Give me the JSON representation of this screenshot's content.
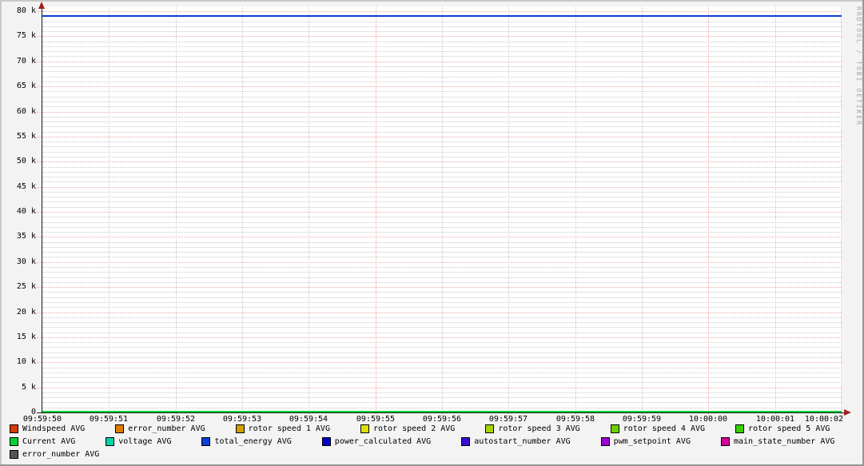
{
  "watermark": "RRDTOOL / TOBI OETIKER",
  "colors": {
    "background": "#f3f3f3",
    "canvas": "#ffffff",
    "grid_minor": "#c9c9c9",
    "grid_major": "#f2a5a5",
    "axis": "#1c1c1c",
    "arrow": "#a32020",
    "shade_a": "#c8c8c8",
    "shade_b": "#969696",
    "watermark_color": "#a6a6a6"
  },
  "legend_layout": [
    7,
    7,
    1
  ],
  "chart_data": {
    "type": "line",
    "title": "",
    "xlabel": "",
    "ylabel": "",
    "ylim": [
      0,
      80000
    ],
    "x_range": {
      "start": "09:59:50",
      "end": "10:00:02",
      "step_seconds": 1
    },
    "grid": {
      "y_minor_step": 1000,
      "y_major_step": 5000,
      "x_minor_step_s": 1,
      "x_major_step_s": 5
    },
    "x_labels": [
      "09:59:50",
      "09:59:51",
      "09:59:52",
      "09:59:53",
      "09:59:54",
      "09:59:55",
      "09:59:56",
      "09:59:57",
      "09:59:58",
      "09:59:59",
      "10:00:00",
      "10:00:01",
      "10:00:02"
    ],
    "y_ticks": [
      {
        "value": 0,
        "label": "0"
      },
      {
        "value": 5000,
        "label": "5 k"
      },
      {
        "value": 10000,
        "label": "10 k"
      },
      {
        "value": 15000,
        "label": "15 k"
      },
      {
        "value": 20000,
        "label": "20 k"
      },
      {
        "value": 25000,
        "label": "25 k"
      },
      {
        "value": 30000,
        "label": "30 k"
      },
      {
        "value": 35000,
        "label": "35 k"
      },
      {
        "value": 40000,
        "label": "40 k"
      },
      {
        "value": 45000,
        "label": "45 k"
      },
      {
        "value": 50000,
        "label": "50 k"
      },
      {
        "value": 55000,
        "label": "55 k"
      },
      {
        "value": 60000,
        "label": "60 k"
      },
      {
        "value": 65000,
        "label": "65 k"
      },
      {
        "value": 70000,
        "label": "70 k"
      },
      {
        "value": 75000,
        "label": "75 k"
      },
      {
        "value": 80000,
        "label": "80 k"
      }
    ],
    "series": [
      {
        "name": "Windspeed AVG",
        "color": "#d93a05",
        "value": 0
      },
      {
        "name": "error_number AVG",
        "color": "#de7c00",
        "value": 0
      },
      {
        "name": "rotor speed 1 AVG",
        "color": "#d09e00",
        "value": 0
      },
      {
        "name": "rotor speed 2 AVG",
        "color": "#dfdf00",
        "value": 0
      },
      {
        "name": "rotor speed 3 AVG",
        "color": "#a6d500",
        "value": 0
      },
      {
        "name": "rotor speed 4 AVG",
        "color": "#6fd000",
        "value": 0
      },
      {
        "name": "rotor speed 5 AVG",
        "color": "#3bd000",
        "value": 0
      },
      {
        "name": "Current AVG",
        "color": "#00d134",
        "value": 0,
        "z": 2
      },
      {
        "name": "voltage AVG",
        "color": "#00d3a6",
        "value": 0
      },
      {
        "name": "total_energy AVG",
        "color": "#0f3fd2",
        "value": 79000,
        "z": 1
      },
      {
        "name": "power_calculated AVG",
        "color": "#0000c8",
        "value": 0
      },
      {
        "name": "autostart_number AVG",
        "color": "#3a0dd0",
        "value": 0
      },
      {
        "name": "pwm_setpoint AVG",
        "color": "#9c00d2",
        "value": 0
      },
      {
        "name": "main_state_number AVG",
        "color": "#d6009b",
        "value": 0
      },
      {
        "name": "error_number AVG",
        "color": "#555555",
        "value": 0
      }
    ]
  }
}
